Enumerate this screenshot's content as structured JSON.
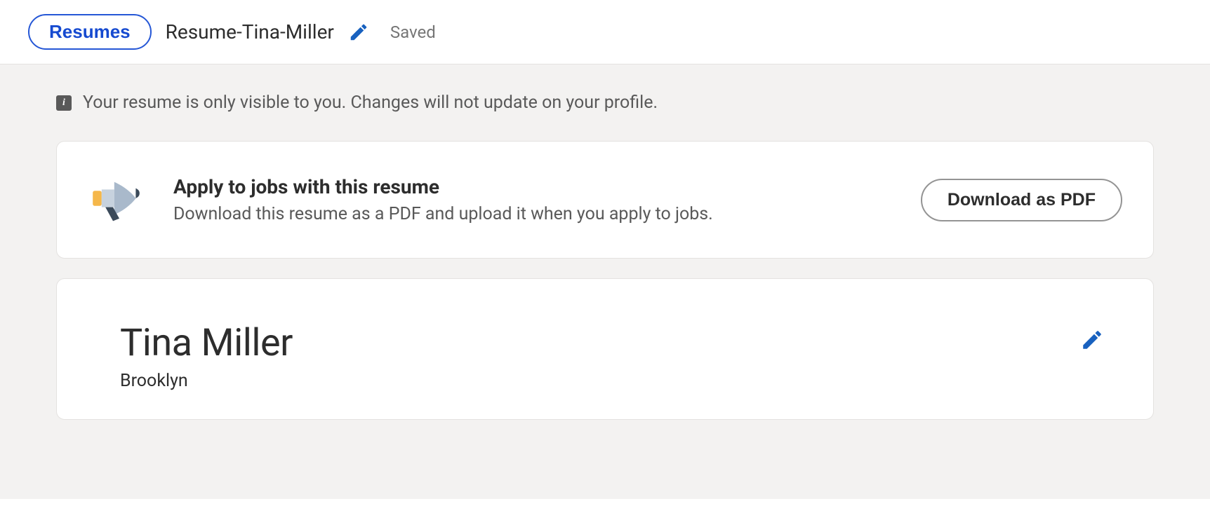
{
  "header": {
    "resumes_label": "Resumes",
    "resume_title": "Resume-Tina-Miller",
    "saved_label": "Saved"
  },
  "info_banner": {
    "text": "Your resume is only visible to you. Changes will not update on your profile."
  },
  "apply_card": {
    "title": "Apply to jobs with this resume",
    "subtitle": "Download this resume as a PDF and upload it when you apply to jobs.",
    "download_label": "Download as PDF"
  },
  "profile": {
    "name": "Tina Miller",
    "location": "Brooklyn"
  }
}
